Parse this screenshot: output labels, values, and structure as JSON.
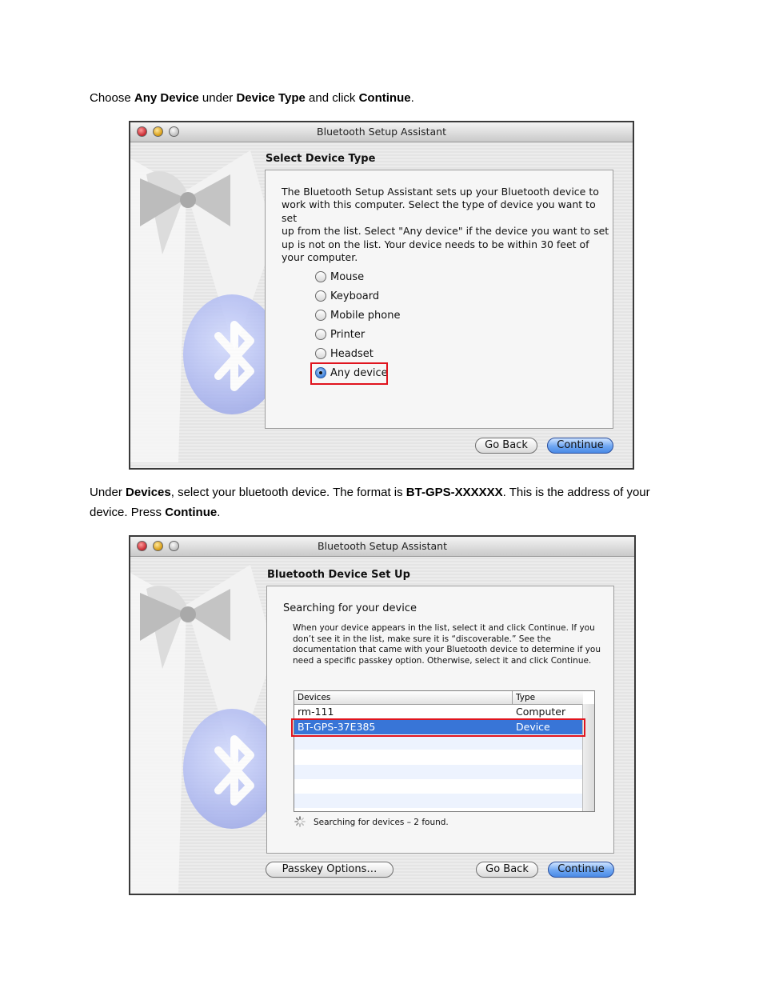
{
  "instruction1": {
    "t1": "Choose ",
    "b1": "Any Device",
    "t2": " under ",
    "b2": "Device Type",
    "t3": " and click ",
    "b3": "Continue",
    "t4": "."
  },
  "window1": {
    "title": "Bluetooth Setup Assistant",
    "section_title": "Select Device Type",
    "intro_lines": [
      "The Bluetooth Setup Assistant sets up your Bluetooth device to",
      "work with this computer. Select the type of device you want to set",
      "up from the list. Select \"Any device\" if the device you want to set",
      "up is not on the list. Your device needs to be within 30 feet of",
      "your computer."
    ],
    "options": [
      {
        "label": "Mouse",
        "selected": false
      },
      {
        "label": "Keyboard",
        "selected": false
      },
      {
        "label": "Mobile phone",
        "selected": false
      },
      {
        "label": "Printer",
        "selected": false
      },
      {
        "label": "Headset",
        "selected": false
      },
      {
        "label": "Any device",
        "selected": true
      }
    ],
    "go_back": "Go Back",
    "continue": "Continue"
  },
  "instruction2": {
    "t1": "Under ",
    "b1": "Devices",
    "t2": ", select your bluetooth device.  The format is ",
    "b2": "BT-GPS-XXXXXX",
    "t3": ". This is the address of your",
    "t4": "device. Press ",
    "b3": "Continue",
    "t5": "."
  },
  "window2": {
    "title": "Bluetooth Setup Assistant",
    "section_title": "Bluetooth Device Set Up",
    "subhead": "Searching for your device",
    "help_lines": [
      "When your device appears in the list, select it and click Continue. If you",
      "don’t see it in the list, make sure it is “discoverable.” See the",
      "documentation that came with your Bluetooth device to determine if you",
      "need a specific passkey option. Otherwise, select it and click Continue."
    ],
    "table": {
      "headers": [
        "Devices",
        "Type"
      ],
      "rows": [
        {
          "device": "rm-111",
          "type": "Computer",
          "selected": false
        },
        {
          "device": "BT-GPS-37E385",
          "type": "Device",
          "selected": true
        }
      ]
    },
    "status": "Searching for devices – 2 found.",
    "passkey": "Passkey Options…",
    "go_back": "Go Back",
    "continue": "Continue"
  },
  "colors": {
    "highlight": "#e0141e",
    "selection": "#3875d7",
    "primary_button": "#4a8ae6"
  }
}
